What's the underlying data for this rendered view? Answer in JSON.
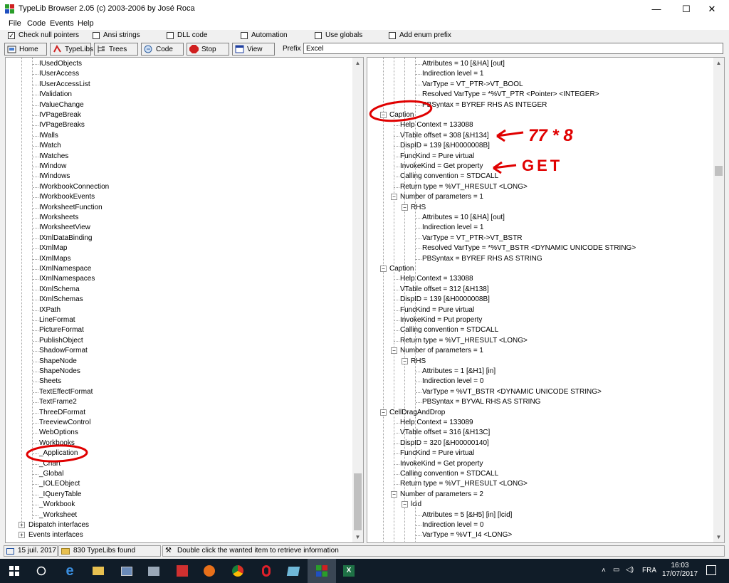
{
  "window": {
    "title": "TypeLib Browser 2.05 (c) 2003-2006 by José Roca",
    "minimize": "—",
    "maximize": "☐",
    "close": "✕"
  },
  "menu": [
    "File",
    "Code",
    "Events",
    "Help"
  ],
  "options": [
    {
      "label": "Check null pointers",
      "checked": true
    },
    {
      "label": "Ansi strings",
      "checked": false
    },
    {
      "label": "DLL code",
      "checked": false
    },
    {
      "label": "Automation",
      "checked": false
    },
    {
      "label": "Use globals",
      "checked": false
    },
    {
      "label": "Add enum prefix",
      "checked": false
    }
  ],
  "toolbar": {
    "home": "Home",
    "typelibs": "TypeLibs",
    "trees": "Trees",
    "code": "Code",
    "stop": "Stop",
    "view": "View",
    "prefix_label": "Prefix",
    "prefix_value": "Excel"
  },
  "left_tree": {
    "items": [
      "IUsedObjects",
      "IUserAccess",
      "IUserAccessList",
      "IValidation",
      "IValueChange",
      "IVPageBreak",
      "IVPageBreaks",
      "IWalls",
      "IWatch",
      "IWatches",
      "IWindow",
      "IWindows",
      "IWorkbookConnection",
      "IWorkbookEvents",
      "IWorksheetFunction",
      "IWorksheets",
      "IWorksheetView",
      "IXmlDataBinding",
      "IXmlMap",
      "IXmlMaps",
      "IXmlNamespace",
      "IXmlNamespaces",
      "IXmlSchema",
      "IXmlSchemas",
      "IXPath",
      "LineFormat",
      "PictureFormat",
      "PublishObject",
      "ShadowFormat",
      "ShapeNode",
      "ShapeNodes",
      "Sheets",
      "TextEffectFormat",
      "TextFrame2",
      "ThreeDFormat",
      "TreeviewControl",
      "WebOptions",
      "Workbooks",
      "_Application",
      "_Chart",
      "_Global",
      "_IOLEObject",
      "_IQueryTable",
      "_Workbook",
      "_Worksheet"
    ],
    "groups": [
      "Dispatch interfaces",
      "Events interfaces"
    ]
  },
  "right_tree": [
    {
      "lvl": 3,
      "t": "Attributes = 10 [&HA]  [out]"
    },
    {
      "lvl": 3,
      "t": "Indirection level = 1"
    },
    {
      "lvl": 3,
      "t": "VarType = VT_PTR->VT_BOOL"
    },
    {
      "lvl": 3,
      "t": "Resolved VarType = *%VT_PTR <Pointer> <INTEGER>"
    },
    {
      "lvl": 3,
      "t": "PBSyntax = BYREF RHS AS INTEGER"
    },
    {
      "lvl": 0,
      "t": "Caption",
      "exp": "-"
    },
    {
      "lvl": 1,
      "t": "Help Context = 133088"
    },
    {
      "lvl": 1,
      "t": "VTable offset = 308 [&H134]"
    },
    {
      "lvl": 1,
      "t": "DispID = 139 [&H0000008B]"
    },
    {
      "lvl": 1,
      "t": "FuncKind = Pure virtual"
    },
    {
      "lvl": 1,
      "t": "InvokeKind = Get property"
    },
    {
      "lvl": 1,
      "t": "Calling convention = STDCALL"
    },
    {
      "lvl": 1,
      "t": "Return type = %VT_HRESULT <LONG>"
    },
    {
      "lvl": 1,
      "t": "Number of parameters = 1",
      "exp": "-"
    },
    {
      "lvl": 2,
      "t": "RHS",
      "exp": "-"
    },
    {
      "lvl": 3,
      "t": "Attributes = 10 [&HA]  [out]"
    },
    {
      "lvl": 3,
      "t": "Indirection level = 1"
    },
    {
      "lvl": 3,
      "t": "VarType = VT_PTR->VT_BSTR"
    },
    {
      "lvl": 3,
      "t": "Resolved VarType = *%VT_BSTR <DYNAMIC UNICODE STRING>"
    },
    {
      "lvl": 3,
      "t": "PBSyntax = BYREF RHS AS STRING"
    },
    {
      "lvl": 0,
      "t": "Caption",
      "exp": "-"
    },
    {
      "lvl": 1,
      "t": "Help Context = 133088"
    },
    {
      "lvl": 1,
      "t": "VTable offset = 312 [&H138]"
    },
    {
      "lvl": 1,
      "t": "DispID = 139 [&H0000008B]"
    },
    {
      "lvl": 1,
      "t": "FuncKind = Pure virtual"
    },
    {
      "lvl": 1,
      "t": "InvokeKind = Put property"
    },
    {
      "lvl": 1,
      "t": "Calling convention = STDCALL"
    },
    {
      "lvl": 1,
      "t": "Return type = %VT_HRESULT <LONG>"
    },
    {
      "lvl": 1,
      "t": "Number of parameters = 1",
      "exp": "-"
    },
    {
      "lvl": 2,
      "t": "RHS",
      "exp": "-"
    },
    {
      "lvl": 3,
      "t": "Attributes = 1 [&H1]  [in]"
    },
    {
      "lvl": 3,
      "t": "Indirection level = 0"
    },
    {
      "lvl": 3,
      "t": "VarType = %VT_BSTR <DYNAMIC UNICODE STRING>"
    },
    {
      "lvl": 3,
      "t": "PBSyntax = BYVAL RHS AS STRING"
    },
    {
      "lvl": 0,
      "t": "CellDragAndDrop",
      "exp": "-"
    },
    {
      "lvl": 1,
      "t": "Help Context = 133089"
    },
    {
      "lvl": 1,
      "t": "VTable offset = 316 [&H13C]"
    },
    {
      "lvl": 1,
      "t": "DispID = 320 [&H00000140]"
    },
    {
      "lvl": 1,
      "t": "FuncKind = Pure virtual"
    },
    {
      "lvl": 1,
      "t": "InvokeKind = Get property"
    },
    {
      "lvl": 1,
      "t": "Calling convention = STDCALL"
    },
    {
      "lvl": 1,
      "t": "Return type = %VT_HRESULT <LONG>"
    },
    {
      "lvl": 1,
      "t": "Number of parameters = 2",
      "exp": "-"
    },
    {
      "lvl": 2,
      "t": "lcid",
      "exp": "-"
    },
    {
      "lvl": 3,
      "t": "Attributes = 5 [&H5]  [in] [lcid]"
    },
    {
      "lvl": 3,
      "t": "Indirection level = 0"
    },
    {
      "lvl": 3,
      "t": "VarType = %VT_I4 <LONG>"
    }
  ],
  "annotations": {
    "offset_note": "77 * 8",
    "invoke_note": "GET",
    "color": "#e00000"
  },
  "status": {
    "date": "15 juil. 2017",
    "count": "830 TypeLibs found",
    "hint": "Double click the wanted item to retrieve information"
  },
  "taskbar": {
    "lang": "FRA",
    "time": "16:03",
    "date": "17/07/2017"
  }
}
